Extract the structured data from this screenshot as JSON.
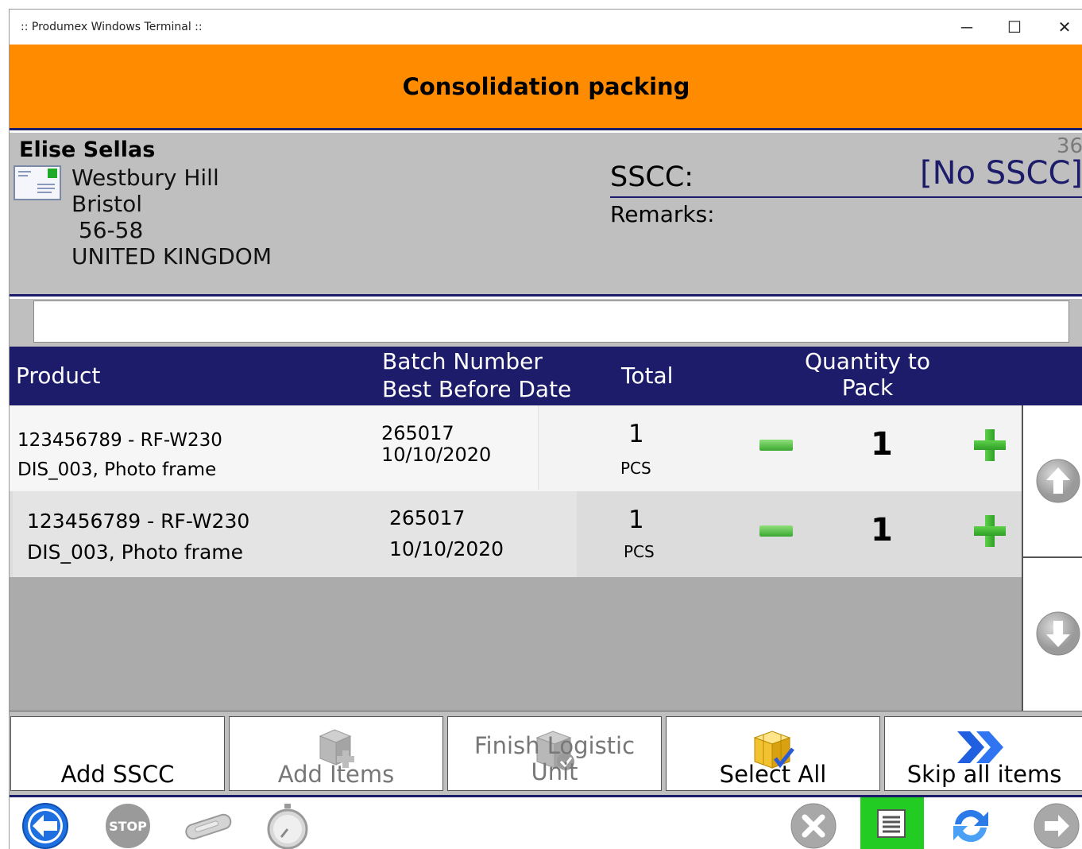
{
  "window": {
    "title": ":: Produmex Windows Terminal ::",
    "minimize": "─",
    "maximize": "☐",
    "close": "✕"
  },
  "header": {
    "title": "Consolidation packing"
  },
  "customer": {
    "name": "Elise Sellas",
    "address_lines": [
      "Westbury Hill",
      "Bristol",
      " 56-58",
      "UNITED KINGDOM"
    ],
    "address_icon": "address-card-icon"
  },
  "sscc": {
    "label": "SSCC:",
    "value": "[No SSCC]",
    "count": "36",
    "remarks_label": "Remarks:"
  },
  "scan": {
    "value": "",
    "placeholder": ""
  },
  "table": {
    "headers": {
      "product": "Product",
      "batch_line1": "Batch Number",
      "batch_line2": "Best Before Date",
      "total": "Total",
      "qty_line1": "Quantity to",
      "qty_line2": "Pack"
    },
    "rows": [
      {
        "product_line1": "123456789 - RF-W230",
        "product_line2": "DIS_003, Photo frame",
        "batch": "265017",
        "bbd": "10/10/2020",
        "total": "1",
        "unit": "PCS",
        "qty": "1"
      },
      {
        "product_line1": "123456789 - RF-W230",
        "product_line2": "DIS_003, Photo frame",
        "batch": "265017",
        "bbd": "10/10/2020",
        "total": "1",
        "unit": "PCS",
        "qty": "1"
      }
    ]
  },
  "buttons": {
    "add_sscc": "Add SSCC",
    "add_items": "Add Items",
    "finish_line1": "Finish Logistic",
    "finish_line2": "Unit",
    "select_all": "Select All",
    "skip_all": "Skip all items"
  },
  "toolbar": {
    "stop_label": "STOP",
    "icons": [
      "back-arrow-icon",
      "stop-icon",
      "scanner-icon",
      "stopwatch-icon",
      "cancel-icon",
      "document-list-icon",
      "refresh-icon",
      "forward-arrow-icon"
    ],
    "active_color": "#22cc22"
  },
  "colors": {
    "header_bg": "#ff8c00",
    "navy": "#1c1c6b",
    "info_bg": "#bfbfbf",
    "plus_minus": "#3aa832"
  }
}
